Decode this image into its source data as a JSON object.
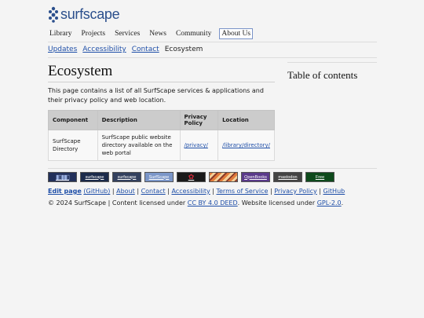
{
  "header": {
    "logo_text": "surfscape",
    "nav": [
      "Library",
      "Projects",
      "Services",
      "News",
      "Community",
      "About Us"
    ],
    "active_nav": "About Us"
  },
  "subnav": {
    "links": [
      "Updates",
      "Accessibility",
      "Contact"
    ],
    "current": "Ecosystem"
  },
  "main": {
    "title": "Ecosystem",
    "intro": "This page contains a list of all SurfScape services & applications and their privacy policy and web location.",
    "table": {
      "headers": [
        "Component",
        "Description",
        "Privacy Policy",
        "Location"
      ],
      "rows": [
        {
          "component": "SurfScape Directory",
          "description": "SurfScape public website directory available on the web portal",
          "privacy": "/privacy/",
          "location": "/library/directory/"
        }
      ]
    }
  },
  "toc": {
    "title": "Table of contents"
  },
  "badges": [
    {
      "name": "city-badge",
      "text": "",
      "bg": "#22305a"
    },
    {
      "name": "surfscape-badge-1",
      "text": "surfscape",
      "bg": "#1b2a4a"
    },
    {
      "name": "surfscape-badge-2",
      "text": "surfscape",
      "bg": "#33405e"
    },
    {
      "name": "surfscape-badge-3",
      "text": "SurfScape",
      "bg": "#7b96c8"
    },
    {
      "name": "flower-badge",
      "text": "",
      "bg": "#1a1a1a"
    },
    {
      "name": "stripes-badge",
      "text": "",
      "bg": "#e07a3a"
    },
    {
      "name": "openbooks-badge",
      "text": "OpenBooks",
      "bg": "#5a3a8a"
    },
    {
      "name": "mastodon-badge",
      "text": "mastodon",
      "bg": "#444444"
    },
    {
      "name": "free-badge",
      "text": "Free",
      "bg": "#0e4a1c"
    }
  ],
  "footer": {
    "edit_page": "Edit page",
    "github_paren": "(GitHub)",
    "links": [
      "About",
      "Contact",
      "Accessibility",
      "Terms of Service",
      "Privacy Policy",
      "GitHub"
    ],
    "copy_prefix": "© 2024 SurfScape | Content licensed under ",
    "cc_license": "CC BY 4.0 DEED",
    "copy_middle": ". Website licensed under ",
    "gpl_license": "GPL-2.0",
    "copy_suffix": "."
  }
}
